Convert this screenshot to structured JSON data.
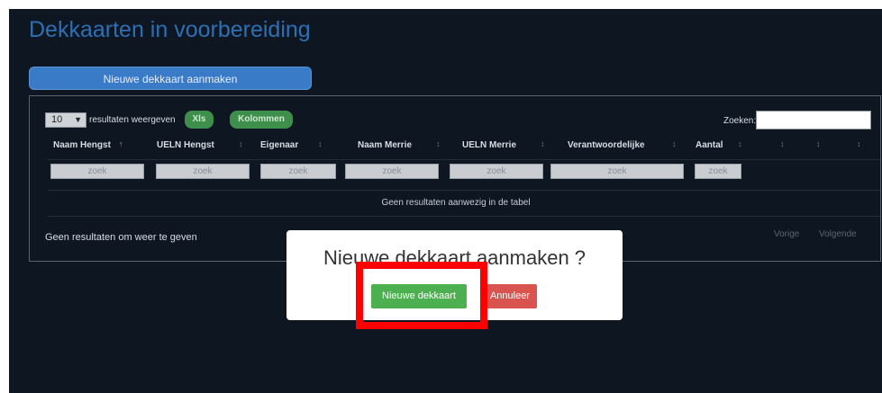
{
  "page": {
    "title": "Dekkaarten in voorbereiding",
    "new_button_label": "Nieuwe dekkaart aanmaken"
  },
  "table_controls": {
    "length_value": "10",
    "length_suffix": "resultaten weergeven",
    "xls_label": "Xls",
    "columns_label": "Kolommen",
    "search_label": "Zoeken:",
    "search_value": ""
  },
  "table": {
    "columns": [
      "Naam Hengst",
      "UELN Hengst",
      "Eigenaar",
      "Naam Merrie",
      "UELN Merrie",
      "Verantwoordelijke",
      "Aantal",
      "",
      "",
      ""
    ],
    "filter_placeholder": "zoek",
    "empty_message": "Geen resultaten aanwezig in de tabel"
  },
  "footer": {
    "info": "Geen resultaten om weer te geven",
    "prev": "Vorige",
    "next": "Volgende"
  },
  "modal": {
    "title": "Nieuwe dekkaart aanmaken ?",
    "confirm_label": "Nieuwe dekkaart",
    "cancel_label": "Annuleer"
  },
  "colors": {
    "background": "#0e1621",
    "accent": "#3a7bc8",
    "success": "#4caf50",
    "danger": "#d9534f",
    "highlight": "#ff0000"
  }
}
